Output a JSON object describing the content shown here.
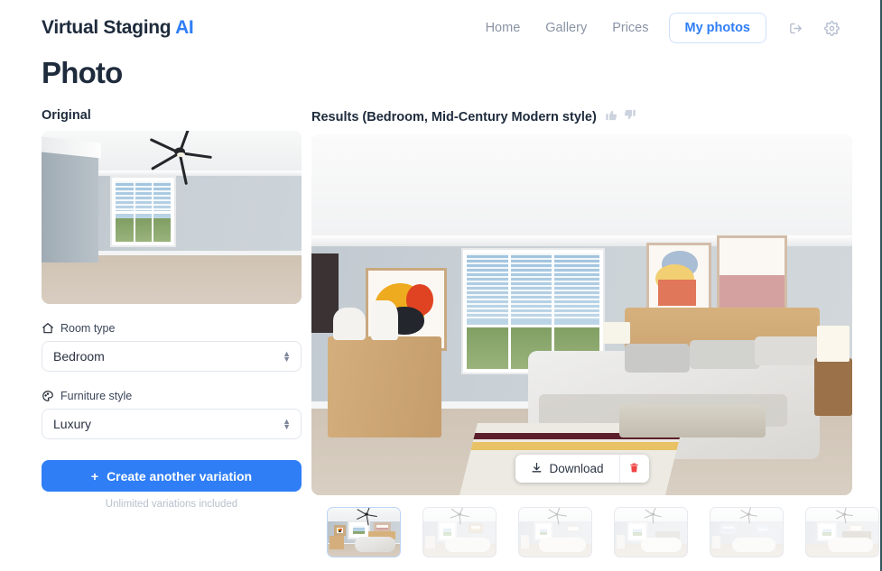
{
  "header": {
    "brand_main": "Virtual Staging ",
    "brand_accent": "AI",
    "nav": [
      {
        "label": "Home",
        "name": "nav-link-home"
      },
      {
        "label": "Gallery",
        "name": "nav-link-gallery"
      },
      {
        "label": "Prices",
        "name": "nav-link-prices"
      }
    ],
    "active_button": "My photos",
    "logout_icon": "logout-icon",
    "settings_icon": "gear-icon"
  },
  "page": {
    "title": "Photo"
  },
  "original": {
    "label": "Original",
    "image_alt": "empty bedroom with ceiling fan and window"
  },
  "controls": {
    "room_type": {
      "icon": "home-icon",
      "label": "Room type",
      "value": "Bedroom"
    },
    "furniture_style": {
      "icon": "palette-icon",
      "label": "Furniture style",
      "value": "Luxury"
    },
    "create_button": {
      "plus": "+",
      "label": "Create another variation"
    },
    "create_note": "Unlimited variations included"
  },
  "results": {
    "label": "Results (Bedroom, Mid-Century Modern style)",
    "thumbs_up_icon": "thumbs-up-icon",
    "thumbs_down_icon": "thumbs-down-icon",
    "actions": {
      "download_icon": "download-icon",
      "download_label": "Download",
      "delete_icon": "trash-icon"
    },
    "thumbnails": [
      {
        "name": "variation-thumbnail-1",
        "selected": true
      },
      {
        "name": "variation-thumbnail-2",
        "selected": false
      },
      {
        "name": "variation-thumbnail-3",
        "selected": false
      },
      {
        "name": "variation-thumbnail-4",
        "selected": false
      },
      {
        "name": "variation-thumbnail-5",
        "selected": false
      },
      {
        "name": "variation-thumbnail-6",
        "selected": false
      },
      {
        "name": "variation-thumbnail-7",
        "selected": false
      }
    ]
  },
  "colors": {
    "accent_blue": "#2f7ef6",
    "text_dark": "#1e2b3c",
    "muted": "#8a94a6",
    "danger_red": "#ef4444"
  }
}
